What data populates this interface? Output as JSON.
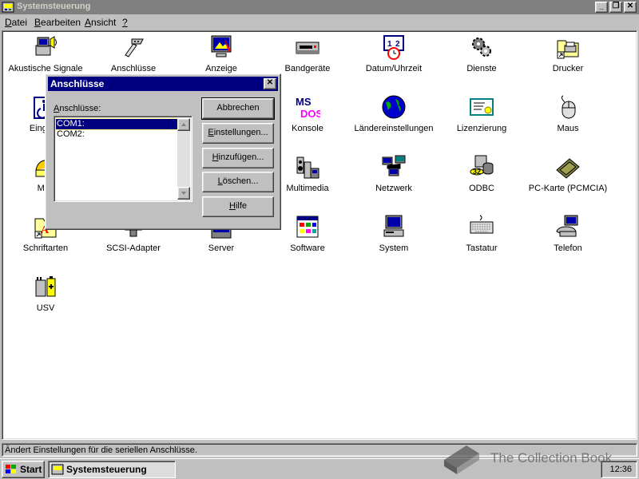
{
  "window": {
    "title": "Systemsteuerung"
  },
  "menubar": {
    "items": [
      {
        "label_u": "D",
        "label_rest": "atei"
      },
      {
        "label_u": "B",
        "label_rest": "earbeiten"
      },
      {
        "label_u": "A",
        "label_rest": "nsicht"
      },
      {
        "label_u": "?",
        "label_rest": ""
      }
    ]
  },
  "icons": [
    {
      "label": "Akustische Signale",
      "icon": "speaker-icon"
    },
    {
      "label": "Anschlüsse",
      "icon": "serial-connector-icon"
    },
    {
      "label": "Anzeige",
      "icon": "display-icon"
    },
    {
      "label": "Bandgeräte",
      "icon": "tape-drive-icon"
    },
    {
      "label": "Datum/Uhrzeit",
      "icon": "calendar-clock-icon"
    },
    {
      "label": "Dienste",
      "icon": "gears-icon"
    },
    {
      "label": "Drucker",
      "icon": "printer-folder-icon"
    },
    {
      "label": "Eingabe",
      "icon": "accessibility-icon"
    },
    {
      "label": "",
      "icon": "hidden-icon"
    },
    {
      "label": "",
      "icon": "hidden-icon"
    },
    {
      "label": "Konsole",
      "icon": "msdos-icon"
    },
    {
      "label": "Ländereinstellungen",
      "icon": "globe-icon"
    },
    {
      "label": "Lizenzierung",
      "icon": "certificate-icon"
    },
    {
      "label": "Maus",
      "icon": "mouse-icon"
    },
    {
      "label": "Moc",
      "icon": "modem-icon"
    },
    {
      "label": "",
      "icon": "hidden-icon"
    },
    {
      "label": "",
      "icon": "hidden-icon"
    },
    {
      "label": "Multimedia",
      "icon": "multimedia-icon"
    },
    {
      "label": "Netzwerk",
      "icon": "network-icon"
    },
    {
      "label": "ODBC",
      "icon": "odbc-icon"
    },
    {
      "label": "PC-Karte (PCMCIA)",
      "icon": "pccard-icon"
    },
    {
      "label": "Schriftarten",
      "icon": "fonts-folder-icon"
    },
    {
      "label": "SCSI-Adapter",
      "icon": "scsi-icon"
    },
    {
      "label": "Server",
      "icon": "server-icon"
    },
    {
      "label": "Software",
      "icon": "software-icon"
    },
    {
      "label": "System",
      "icon": "computer-icon"
    },
    {
      "label": "Tastatur",
      "icon": "keyboard-icon"
    },
    {
      "label": "Telefon",
      "icon": "telephone-icon"
    },
    {
      "label": "USV",
      "icon": "ups-battery-icon"
    }
  ],
  "dialog": {
    "title": "Anschlüsse",
    "list_label_u": "A",
    "list_label_rest": "nschlüsse:",
    "ports": [
      "COM1:",
      "COM2:"
    ],
    "selected_port": "COM1:",
    "buttons": [
      {
        "u": "",
        "rest": "Abbrechen"
      },
      {
        "u": "E",
        "rest": "instellungen..."
      },
      {
        "u": "H",
        "rest": "inzufügen..."
      },
      {
        "u": "L",
        "rest": "öschen..."
      },
      {
        "u": "H",
        "rest": "ilfe"
      }
    ]
  },
  "statusbar": {
    "text": "Ändert Einstellungen für die seriellen Anschlüsse."
  },
  "taskbar": {
    "start_label": "Start",
    "task_label": "Systemsteuerung",
    "clock": "12:36"
  },
  "watermark": {
    "text": "The Collection Book"
  }
}
